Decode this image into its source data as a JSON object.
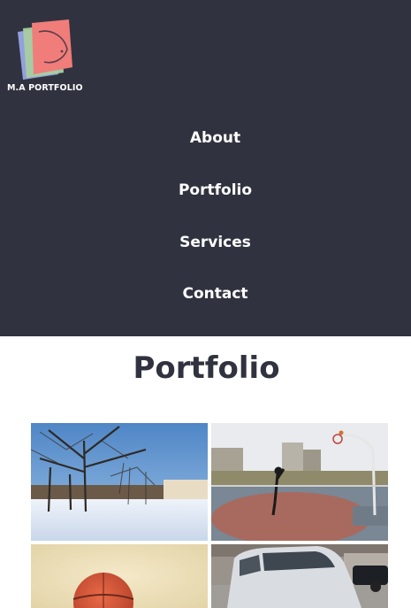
{
  "brand": {
    "logo_text": "M.A PORTFOLIO",
    "logo_icon": "stacked-pages-logo"
  },
  "nav": {
    "items": [
      "About",
      "Portfolio",
      "Services",
      "Contact"
    ]
  },
  "portfolio": {
    "title": "Portfolio",
    "images": [
      {
        "name": "snowy-park-photo"
      },
      {
        "name": "basketball-court-photo"
      },
      {
        "name": "basketball-closeup-photo"
      },
      {
        "name": "parked-car-photo"
      }
    ]
  },
  "colors": {
    "header_bg": "#30333f",
    "nav_text": "#ffffff",
    "title_text": "#30333f",
    "page_bg": "#ffffff"
  }
}
